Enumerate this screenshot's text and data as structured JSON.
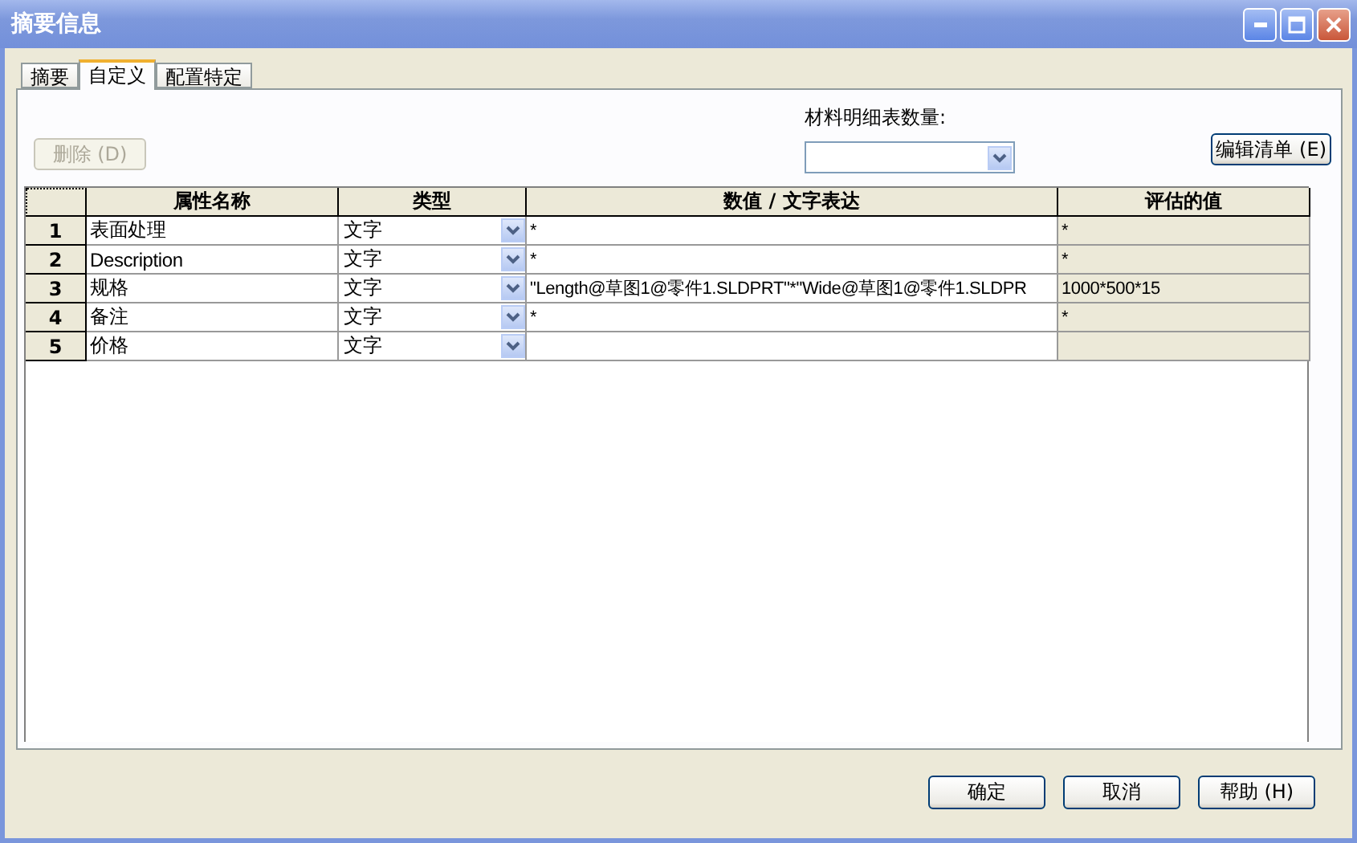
{
  "window": {
    "title": "摘要信息"
  },
  "tabs": [
    {
      "label": "摘要",
      "selected": false
    },
    {
      "label": "自定义",
      "selected": true
    },
    {
      "label": "配置特定",
      "selected": false
    }
  ],
  "delete_button": {
    "label": "删除 (D)",
    "disabled": true
  },
  "bom_quantity": {
    "label": "材料明细表数量:"
  },
  "edit_list_button": {
    "label": "编辑清单 (E)"
  },
  "table": {
    "columns": [
      "属性名称",
      "类型",
      "数值 / 文字表达",
      "评估的值"
    ],
    "rows": [
      {
        "number": "1",
        "name": "表面处理",
        "type": "文字",
        "value": "*",
        "evaluated": "*"
      },
      {
        "number": "2",
        "name": "Description",
        "type": "文字",
        "value": "*",
        "evaluated": "*"
      },
      {
        "number": "3",
        "name": "规格",
        "type": "文字",
        "value": "\"Length@草图1@零件1.SLDPRT\"*\"Wide@草图1@零件1.SLDPR",
        "evaluated": "1000*500*15"
      },
      {
        "number": "4",
        "name": "备注",
        "type": "文字",
        "value": "*",
        "evaluated": "*"
      },
      {
        "number": "5",
        "name": "价格",
        "type": "文字"
      }
    ]
  },
  "buttons": [
    {
      "label": "确定"
    },
    {
      "label": "取消"
    },
    {
      "label": "帮助 (H)"
    }
  ]
}
